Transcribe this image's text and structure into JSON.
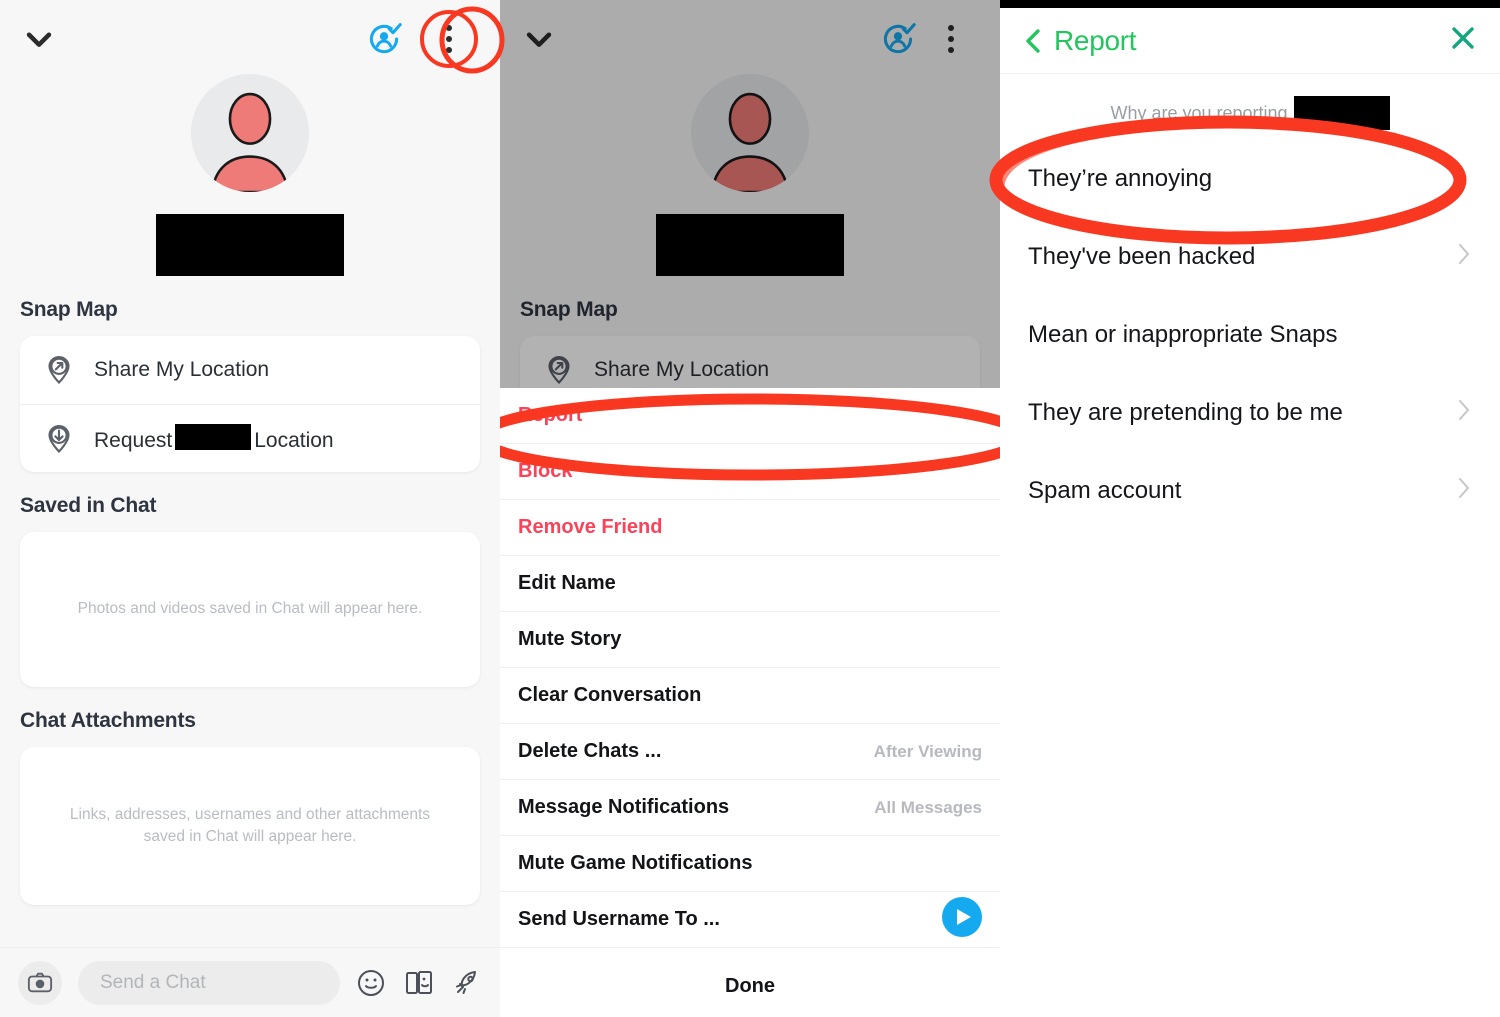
{
  "colors": {
    "annotation_red": "#f93822",
    "green_accent": "#22c55e",
    "teal_close": "#14a67e",
    "danger_red": "#fa4359",
    "blue_icon": "#15aaf0",
    "avatar_red": "#ef7b78"
  },
  "profile_panel": {
    "chevron_down_icon": "chevron-down-icon",
    "add_friend_icon": "friend-added-icon",
    "more_options_icon": "kebab-menu-icon",
    "avatar_icon": "avatar",
    "display_name_redacted": "",
    "snap_map": {
      "title": "Snap Map",
      "rows": [
        {
          "label": "Share My Location",
          "icon": "location-share-pin-icon"
        },
        {
          "label_prefix": "Request",
          "label_suffix": "Location",
          "icon": "location-request-pin-icon"
        }
      ]
    },
    "saved_in_chat": {
      "title": "Saved in Chat",
      "empty_text": "Photos and videos saved in Chat will appear here."
    },
    "chat_attachments": {
      "title": "Chat Attachments",
      "empty_text": "Links, addresses, usernames and other attachments saved in Chat will appear here."
    },
    "bottom_bar": {
      "camera_icon": "camera-icon",
      "chat_placeholder": "Send a Chat",
      "icons": [
        "sticker-smiley-icon",
        "cards-sticker-icon",
        "rocket-icon"
      ]
    }
  },
  "menu_panel": {
    "chevron_down_icon": "chevron-down-icon",
    "add_friend_icon": "friend-added-icon",
    "more_options_icon": "kebab-menu-icon",
    "snap_map_title": "Snap Map",
    "share_location_label": "Share My Location",
    "items": [
      {
        "label": "Report",
        "style": "danger",
        "value": ""
      },
      {
        "label": "Block",
        "style": "danger",
        "value": ""
      },
      {
        "label": "Remove Friend",
        "style": "danger",
        "value": ""
      },
      {
        "label": "Edit Name",
        "style": "normal",
        "value": ""
      },
      {
        "label": "Mute Story",
        "style": "normal",
        "value": ""
      },
      {
        "label": "Clear Conversation",
        "style": "normal",
        "value": ""
      },
      {
        "label": "Delete Chats ...",
        "style": "normal",
        "value": "After Viewing"
      },
      {
        "label": "Message Notifications",
        "style": "normal",
        "value": "All Messages"
      },
      {
        "label": "Mute Game Notifications",
        "style": "normal",
        "value": ""
      },
      {
        "label": "Send Username To ...",
        "style": "normal",
        "value": "",
        "trailing_icon": "send-arrow-icon"
      }
    ],
    "done_label": "Done"
  },
  "report_panel": {
    "back_icon": "back-chevron-icon",
    "title": "Report",
    "close_icon": "close-icon",
    "question_text": "Why are you reporting",
    "options": [
      {
        "label": "They’re annoying",
        "chevron": false
      },
      {
        "label": "They've been hacked",
        "chevron": true
      },
      {
        "label": "Mean or inappropriate Snaps",
        "chevron": false
      },
      {
        "label": "They are pretending to be me",
        "chevron": true
      },
      {
        "label": "Spam account",
        "chevron": true
      }
    ]
  }
}
